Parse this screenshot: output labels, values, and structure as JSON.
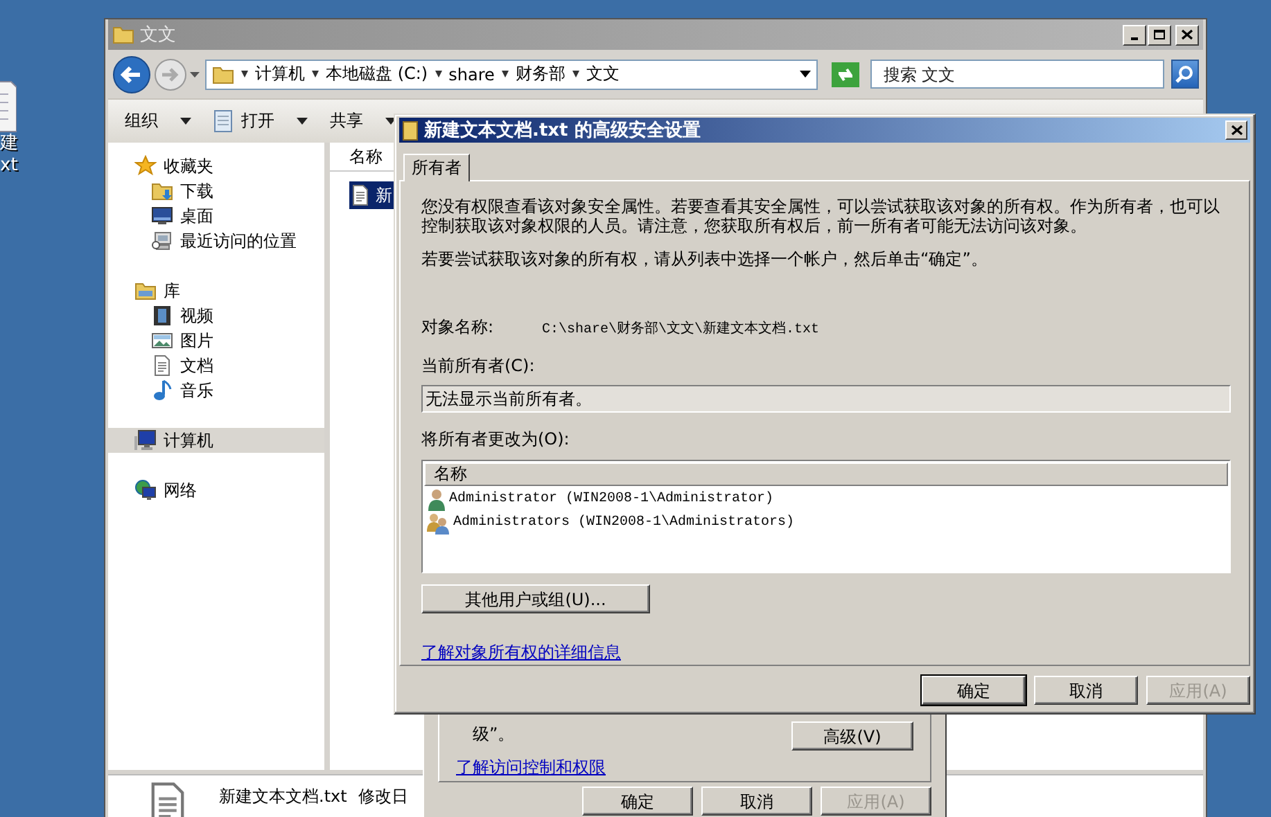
{
  "desktop": {
    "icon_label_lines": [
      "建",
      "xt"
    ]
  },
  "explorer": {
    "title": "文文",
    "active": false,
    "breadcrumb": [
      "计算机",
      "本地磁盘 (C:)",
      "share",
      "财务部",
      "文文"
    ],
    "search": {
      "placeholder": "搜索 文文"
    },
    "toolbar": [
      {
        "label": "组织",
        "kind": "menu"
      },
      {
        "label": "打开",
        "kind": "document"
      },
      {
        "label": "共享",
        "kind": "menu"
      }
    ],
    "nav": [
      {
        "label": "收藏夹",
        "kind": "favorites",
        "selected": false,
        "children": [
          {
            "label": "下载",
            "kind": "download",
            "selected": false
          },
          {
            "label": "桌面",
            "kind": "desktop",
            "selected": false
          },
          {
            "label": "最近访问的位置",
            "kind": "recent",
            "selected": false
          }
        ]
      },
      {
        "label": "库",
        "kind": "library",
        "selected": false,
        "children": [
          {
            "label": "视频",
            "kind": "video",
            "selected": false
          },
          {
            "label": "图片",
            "kind": "picture",
            "selected": false
          },
          {
            "label": "文档",
            "kind": "document",
            "selected": false
          },
          {
            "label": "音乐",
            "kind": "music",
            "selected": false
          }
        ]
      },
      {
        "label": "计算机",
        "kind": "computer",
        "selected": true
      },
      {
        "label": "网络",
        "kind": "network",
        "selected": false
      }
    ],
    "columns": [
      "名称"
    ],
    "files": [
      {
        "name": "新",
        "selected": true
      }
    ],
    "details": {
      "name": "新建文本文档.txt",
      "meta": "修改日"
    }
  },
  "properties_dialog": {
    "text_tail": "级”。",
    "advanced_button": "高级(V)",
    "link": "了解访问控制和权限",
    "buttons": [
      {
        "label": "确定",
        "disabled": false,
        "default": false
      },
      {
        "label": "取消",
        "disabled": false,
        "default": false
      },
      {
        "label": "应用(A)",
        "disabled": true,
        "default": false
      }
    ]
  },
  "advanced_dialog": {
    "title": "新建文本文档.txt 的高级安全设置",
    "active": true,
    "tabs": [
      {
        "label": "所有者",
        "selected": true
      }
    ],
    "intro": "您没有权限查看该对象安全属性。若要查看其安全属性，可以尝试获取该对象的所有权。作为所有者，也可以控制获取该对象权限的人员。请注意，您获取所有权后，前一所有者可能无法访问该对象。",
    "instruction": "若要尝试获取该对象的所有权，请从列表中选择一个帐户，然后单击“确定”。",
    "object_name": {
      "label": "对象名称:",
      "value": "C:\\share\\财务部\\文文\\新建文本文档.txt"
    },
    "current_owner": {
      "label": "当前所有者(C):",
      "value": "无法显示当前所有者。"
    },
    "change_owner": {
      "label": "将所有者更改为(O):",
      "column": "名称",
      "accounts": [
        {
          "name": "Administrator (WIN2008-1\\Administrator)",
          "kind": "user",
          "selected": false
        },
        {
          "name": "Administrators (WIN2008-1\\Administrators)",
          "kind": "group",
          "selected": false
        }
      ]
    },
    "other_button": "其他用户或组(U)...",
    "link": "了解对象所有权的详细信息",
    "buttons": [
      {
        "label": "确定",
        "disabled": false,
        "default": true
      },
      {
        "label": "取消",
        "disabled": false,
        "default": false
      },
      {
        "label": "应用(A)",
        "disabled": true,
        "default": false
      }
    ]
  }
}
